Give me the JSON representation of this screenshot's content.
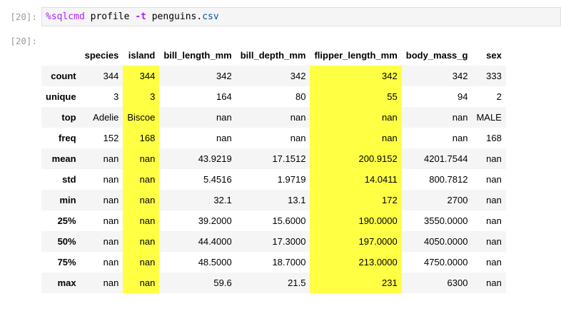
{
  "cell": {
    "in_prompt": "[20]:",
    "out_prompt": "[20]:",
    "code": {
      "magic": "%sqlcmd",
      "text1": " profile ",
      "flag": "-t",
      "text2": " penguins.",
      "ext": "csv"
    }
  },
  "table": {
    "columns": [
      "species",
      "island",
      "bill_length_mm",
      "bill_depth_mm",
      "flipper_length_mm",
      "body_mass_g",
      "sex"
    ],
    "highlighted_columns": [
      "island",
      "flipper_length_mm"
    ],
    "highlight_color": "#ffff44",
    "rows": [
      {
        "label": "count",
        "values": [
          "344",
          "344",
          "342",
          "342",
          "342",
          "342",
          "333"
        ]
      },
      {
        "label": "unique",
        "values": [
          "3",
          "3",
          "164",
          "80",
          "55",
          "94",
          "2"
        ]
      },
      {
        "label": "top",
        "values": [
          "Adelie",
          "Biscoe",
          "nan",
          "nan",
          "nan",
          "nan",
          "MALE"
        ]
      },
      {
        "label": "freq",
        "values": [
          "152",
          "168",
          "nan",
          "nan",
          "nan",
          "nan",
          "168"
        ]
      },
      {
        "label": "mean",
        "values": [
          "nan",
          "nan",
          "43.9219",
          "17.1512",
          "200.9152",
          "4201.7544",
          "nan"
        ]
      },
      {
        "label": "std",
        "values": [
          "nan",
          "nan",
          "5.4516",
          "1.9719",
          "14.0411",
          "800.7812",
          "nan"
        ]
      },
      {
        "label": "min",
        "values": [
          "nan",
          "nan",
          "32.1",
          "13.1",
          "172",
          "2700",
          "nan"
        ]
      },
      {
        "label": "25%",
        "values": [
          "nan",
          "nan",
          "39.2000",
          "15.6000",
          "190.0000",
          "3550.0000",
          "nan"
        ]
      },
      {
        "label": "50%",
        "values": [
          "nan",
          "nan",
          "44.4000",
          "17.3000",
          "197.0000",
          "4050.0000",
          "nan"
        ]
      },
      {
        "label": "75%",
        "values": [
          "nan",
          "nan",
          "48.5000",
          "18.7000",
          "213.0000",
          "4750.0000",
          "nan"
        ]
      },
      {
        "label": "max",
        "values": [
          "nan",
          "nan",
          "59.6",
          "21.5",
          "231",
          "6300",
          "nan"
        ]
      }
    ]
  }
}
